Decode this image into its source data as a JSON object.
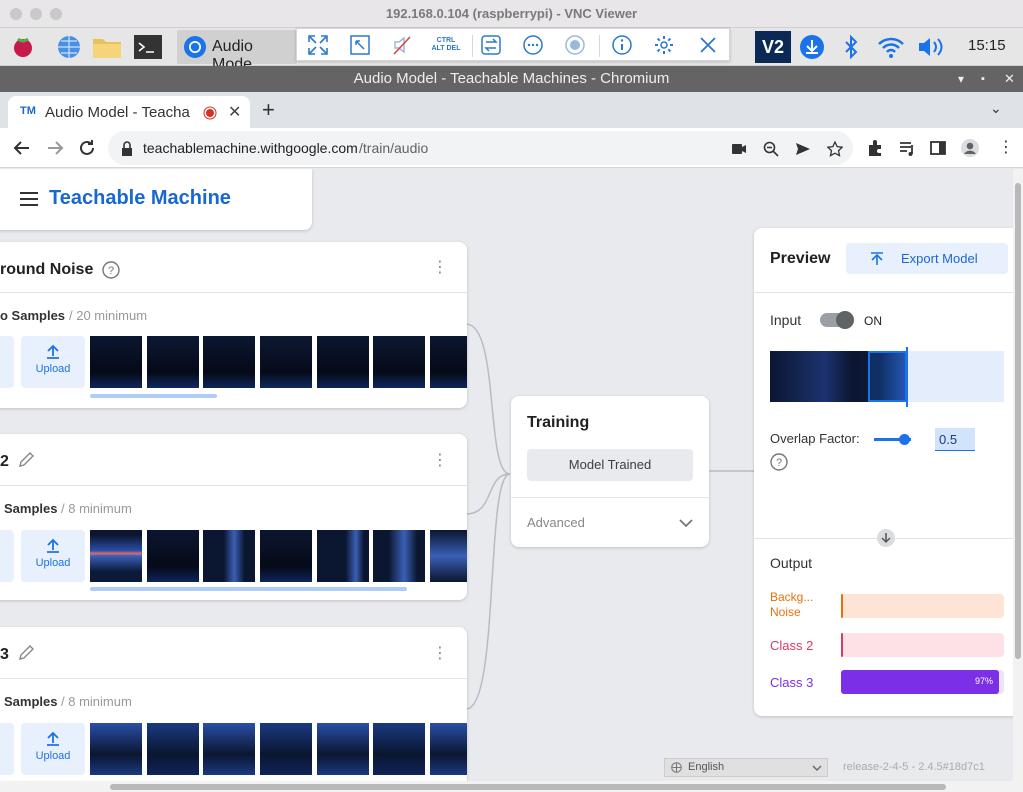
{
  "vnc": {
    "title": "192.168.0.104 (raspberrypi) - VNC Viewer"
  },
  "taskbar": {
    "chromium_label": "Audio Mode",
    "clock": "15:15",
    "vnc_logo": "V2"
  },
  "vnc_toolbar": {
    "ctrl_alt_del": "CTRL ALT DEL"
  },
  "browser": {
    "window_title": "Audio Model - Teachable Machines - Chromium",
    "tab_label": "Audio Model - Teacha",
    "tab_favicon": "TM",
    "url_host": "teachablemachine.withgoogle.com",
    "url_path": "/train/audio"
  },
  "app": {
    "name": "Teachable Machine"
  },
  "classes": [
    {
      "title": "round Noise",
      "samples": "o Samples",
      "minimum": "/ 20 minimum",
      "upload": "Upload"
    },
    {
      "title": "2",
      "samples": "Samples",
      "minimum": "/ 8 minimum",
      "upload": "Upload"
    },
    {
      "title": "3",
      "samples": "Samples",
      "minimum": "/ 8 minimum",
      "upload": "Upload"
    }
  ],
  "training": {
    "title": "Training",
    "button": "Model Trained",
    "advanced": "Advanced"
  },
  "preview": {
    "title": "Preview",
    "export": "Export Model",
    "input_label": "Input",
    "toggle_state": "ON",
    "overlap_label": "Overlap Factor:",
    "overlap_value": "0.5",
    "overlap_level": 0.5,
    "output_label": "Output",
    "outputs": [
      {
        "name": "Backg... Noise",
        "value": 0,
        "color": "#e8710a",
        "bg": "#fde4d4"
      },
      {
        "name": "Class 2",
        "value": 0,
        "color": "#d93a63",
        "bg": "#fde1e6"
      },
      {
        "name": "Class 3",
        "value": 0.97,
        "label": "97%",
        "color": "#7b2fe6",
        "bg": "#ece3fd"
      }
    ]
  },
  "footer": {
    "language": "English",
    "release": "release-2-4-5 - 2.4.5#18d7c1"
  },
  "colors": {
    "accent": "#1a73e8",
    "brand": "#1967d2"
  }
}
